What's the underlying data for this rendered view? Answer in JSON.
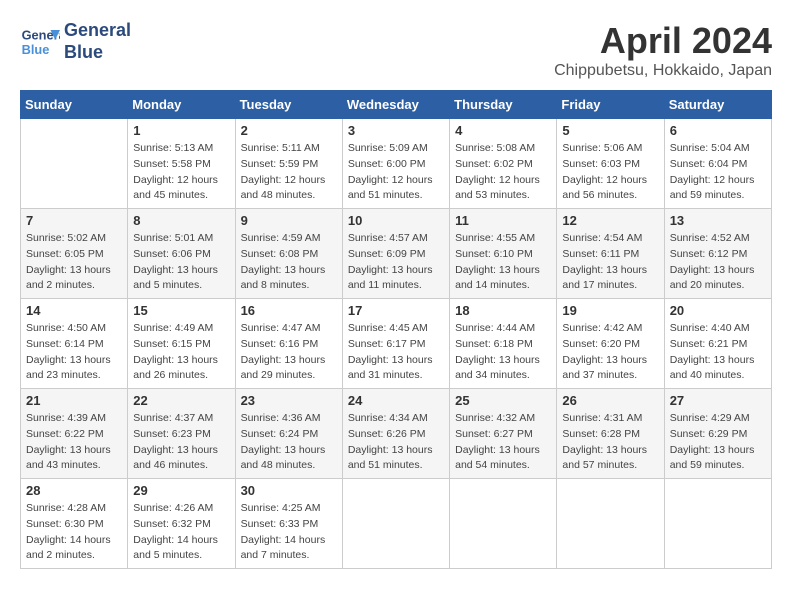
{
  "header": {
    "logo_line1": "General",
    "logo_line2": "Blue",
    "month": "April 2024",
    "location": "Chippubetsu, Hokkaido, Japan"
  },
  "columns": [
    "Sunday",
    "Monday",
    "Tuesday",
    "Wednesday",
    "Thursday",
    "Friday",
    "Saturday"
  ],
  "weeks": [
    [
      {
        "day": "",
        "info": ""
      },
      {
        "day": "1",
        "info": "Sunrise: 5:13 AM\nSunset: 5:58 PM\nDaylight: 12 hours\nand 45 minutes."
      },
      {
        "day": "2",
        "info": "Sunrise: 5:11 AM\nSunset: 5:59 PM\nDaylight: 12 hours\nand 48 minutes."
      },
      {
        "day": "3",
        "info": "Sunrise: 5:09 AM\nSunset: 6:00 PM\nDaylight: 12 hours\nand 51 minutes."
      },
      {
        "day": "4",
        "info": "Sunrise: 5:08 AM\nSunset: 6:02 PM\nDaylight: 12 hours\nand 53 minutes."
      },
      {
        "day": "5",
        "info": "Sunrise: 5:06 AM\nSunset: 6:03 PM\nDaylight: 12 hours\nand 56 minutes."
      },
      {
        "day": "6",
        "info": "Sunrise: 5:04 AM\nSunset: 6:04 PM\nDaylight: 12 hours\nand 59 minutes."
      }
    ],
    [
      {
        "day": "7",
        "info": "Sunrise: 5:02 AM\nSunset: 6:05 PM\nDaylight: 13 hours\nand 2 minutes."
      },
      {
        "day": "8",
        "info": "Sunrise: 5:01 AM\nSunset: 6:06 PM\nDaylight: 13 hours\nand 5 minutes."
      },
      {
        "day": "9",
        "info": "Sunrise: 4:59 AM\nSunset: 6:08 PM\nDaylight: 13 hours\nand 8 minutes."
      },
      {
        "day": "10",
        "info": "Sunrise: 4:57 AM\nSunset: 6:09 PM\nDaylight: 13 hours\nand 11 minutes."
      },
      {
        "day": "11",
        "info": "Sunrise: 4:55 AM\nSunset: 6:10 PM\nDaylight: 13 hours\nand 14 minutes."
      },
      {
        "day": "12",
        "info": "Sunrise: 4:54 AM\nSunset: 6:11 PM\nDaylight: 13 hours\nand 17 minutes."
      },
      {
        "day": "13",
        "info": "Sunrise: 4:52 AM\nSunset: 6:12 PM\nDaylight: 13 hours\nand 20 minutes."
      }
    ],
    [
      {
        "day": "14",
        "info": "Sunrise: 4:50 AM\nSunset: 6:14 PM\nDaylight: 13 hours\nand 23 minutes."
      },
      {
        "day": "15",
        "info": "Sunrise: 4:49 AM\nSunset: 6:15 PM\nDaylight: 13 hours\nand 26 minutes."
      },
      {
        "day": "16",
        "info": "Sunrise: 4:47 AM\nSunset: 6:16 PM\nDaylight: 13 hours\nand 29 minutes."
      },
      {
        "day": "17",
        "info": "Sunrise: 4:45 AM\nSunset: 6:17 PM\nDaylight: 13 hours\nand 31 minutes."
      },
      {
        "day": "18",
        "info": "Sunrise: 4:44 AM\nSunset: 6:18 PM\nDaylight: 13 hours\nand 34 minutes."
      },
      {
        "day": "19",
        "info": "Sunrise: 4:42 AM\nSunset: 6:20 PM\nDaylight: 13 hours\nand 37 minutes."
      },
      {
        "day": "20",
        "info": "Sunrise: 4:40 AM\nSunset: 6:21 PM\nDaylight: 13 hours\nand 40 minutes."
      }
    ],
    [
      {
        "day": "21",
        "info": "Sunrise: 4:39 AM\nSunset: 6:22 PM\nDaylight: 13 hours\nand 43 minutes."
      },
      {
        "day": "22",
        "info": "Sunrise: 4:37 AM\nSunset: 6:23 PM\nDaylight: 13 hours\nand 46 minutes."
      },
      {
        "day": "23",
        "info": "Sunrise: 4:36 AM\nSunset: 6:24 PM\nDaylight: 13 hours\nand 48 minutes."
      },
      {
        "day": "24",
        "info": "Sunrise: 4:34 AM\nSunset: 6:26 PM\nDaylight: 13 hours\nand 51 minutes."
      },
      {
        "day": "25",
        "info": "Sunrise: 4:32 AM\nSunset: 6:27 PM\nDaylight: 13 hours\nand 54 minutes."
      },
      {
        "day": "26",
        "info": "Sunrise: 4:31 AM\nSunset: 6:28 PM\nDaylight: 13 hours\nand 57 minutes."
      },
      {
        "day": "27",
        "info": "Sunrise: 4:29 AM\nSunset: 6:29 PM\nDaylight: 13 hours\nand 59 minutes."
      }
    ],
    [
      {
        "day": "28",
        "info": "Sunrise: 4:28 AM\nSunset: 6:30 PM\nDaylight: 14 hours\nand 2 minutes."
      },
      {
        "day": "29",
        "info": "Sunrise: 4:26 AM\nSunset: 6:32 PM\nDaylight: 14 hours\nand 5 minutes."
      },
      {
        "day": "30",
        "info": "Sunrise: 4:25 AM\nSunset: 6:33 PM\nDaylight: 14 hours\nand 7 minutes."
      },
      {
        "day": "",
        "info": ""
      },
      {
        "day": "",
        "info": ""
      },
      {
        "day": "",
        "info": ""
      },
      {
        "day": "",
        "info": ""
      }
    ]
  ]
}
